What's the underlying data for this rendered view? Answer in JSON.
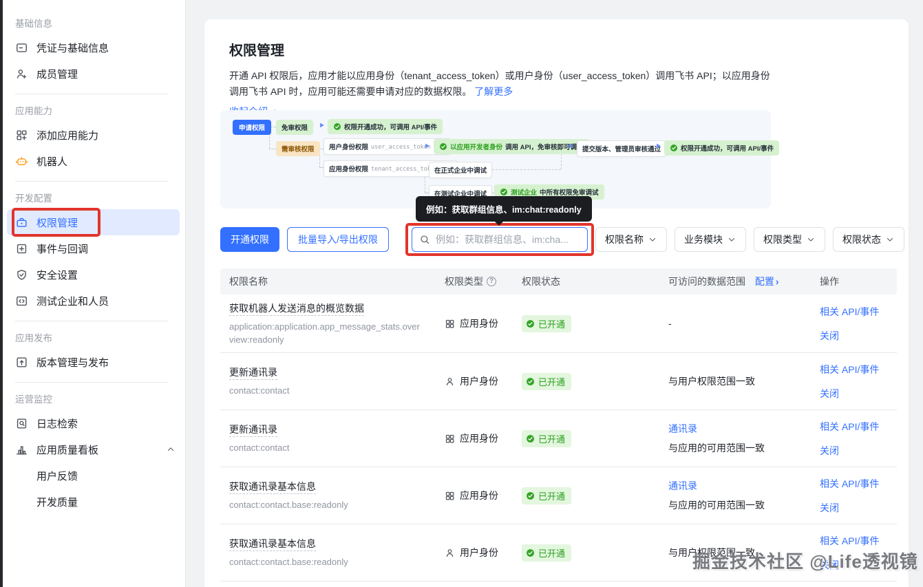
{
  "sidebar": {
    "sections": [
      {
        "label": "基础信息",
        "items": [
          {
            "label": "凭证与基础信息"
          },
          {
            "label": "成员管理"
          }
        ]
      },
      {
        "label": "应用能力",
        "items": [
          {
            "label": "添加应用能力"
          },
          {
            "label": "机器人"
          }
        ]
      },
      {
        "label": "开发配置",
        "items": [
          {
            "label": "权限管理",
            "selected": true
          },
          {
            "label": "事件与回调"
          },
          {
            "label": "安全设置"
          },
          {
            "label": "测试企业和人员"
          }
        ]
      },
      {
        "label": "应用发布",
        "items": [
          {
            "label": "版本管理与发布"
          }
        ]
      },
      {
        "label": "运营监控",
        "items": [
          {
            "label": "日志检索"
          },
          {
            "label": "应用质量看板",
            "expanded": true
          }
        ],
        "children": [
          {
            "label": "用户反馈"
          },
          {
            "label": "开发质量"
          }
        ]
      }
    ]
  },
  "header": {
    "title": "权限管理",
    "description": "开通 API 权限后，应用才能以应用身份（tenant_access_token）或用户身份（user_access_token）调用飞书 API；以应用身份调用飞书 API 时，应用可能还需要申请对应的数据权限。",
    "learn_more": "了解更多",
    "collapse_intro": "收起介绍"
  },
  "diagram": {
    "apply": "申请权限",
    "no_review": "免审权限",
    "success_top": "权限开通成功，可调用 API/事件",
    "need_review": "需审核权限",
    "user_identity": "用户身份权限",
    "user_token": "user_access_token 调用",
    "app_identity": "应用身份权限",
    "app_token": "tenant_access_token 调用",
    "dev_debug_highlight": "以应用开发者身份",
    "dev_debug_rest": "调用 API，免审核即可调试",
    "submit_review": "提交版本、管理员审核通过",
    "success_mid": "权限开通成功，可调用 API/事件",
    "formal_debug": "在正式企业中调试",
    "test_debug": "在测试企业中调试",
    "test_free_highlight": "测试企业",
    "test_free_rest": "中所有权限免审调试"
  },
  "toolbar": {
    "open_permission": "开通权限",
    "batch_import_export": "批量导入/导出权限",
    "search_placeholder": "例如：获取群组信息、im:cha...",
    "tooltip": "例如：获取群组信息、im:chat:readonly",
    "filters": [
      "权限名称",
      "业务模块",
      "权限类型",
      "权限状态"
    ]
  },
  "table": {
    "headers": {
      "name": "权限名称",
      "type": "权限类型",
      "type_help": "?",
      "status": "权限状态",
      "scope": "可访问的数据范围",
      "scope_config": "配置",
      "scope_chevron": "›",
      "action": "操作"
    },
    "action_labels": [
      "相关 API/事件",
      "关闭"
    ],
    "rows": [
      {
        "name": "获取机器人发送消息的概览数据",
        "code": "application:application.app_message_stats.overview:readonly",
        "type": "应用身份",
        "type_kind": "app",
        "status": "已开通",
        "scope_text": "-"
      },
      {
        "name": "更新通讯录",
        "code": "contact:contact",
        "type": "用户身份",
        "type_kind": "user",
        "status": "已开通",
        "scope_text": "与用户权限范围一致"
      },
      {
        "name": "更新通讯录",
        "code": "contact:contact",
        "type": "应用身份",
        "type_kind": "app",
        "status": "已开通",
        "scope_link": "通讯录",
        "scope_text": "与应用的可用范围一致"
      },
      {
        "name": "获取通讯录基本信息",
        "code": "contact:contact.base:readonly",
        "type": "应用身份",
        "type_kind": "app",
        "status": "已开通",
        "scope_link": "通讯录",
        "scope_text": "与应用的可用范围一致"
      },
      {
        "name": "获取通讯录基本信息",
        "code": "contact:contact.base:readonly",
        "type": "用户身份",
        "type_kind": "user",
        "status": "已开通",
        "scope_text": "与用户权限范围一致"
      }
    ]
  },
  "watermark": {
    "text": "掘金技术社区 @Life透视镜"
  },
  "colors": {
    "accent": "#3370ff",
    "link": "#3370ff",
    "success_text": "#2ea121",
    "success_bg": "#e3f6de",
    "diagram_green_bg": "#d6f1cf",
    "diagram_orange_bg": "#f9e5c3",
    "diagram_orange_text": "#8a5300",
    "annotation_red": "#e2342c",
    "sidebar_selected_bg": "#e1eaff",
    "robot_icon": "#ff9d1c"
  }
}
